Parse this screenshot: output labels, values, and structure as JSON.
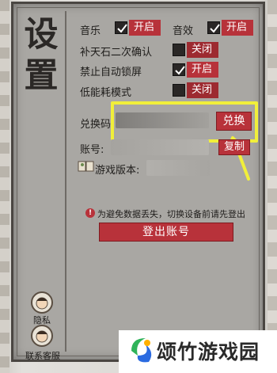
{
  "settings": {
    "title": "设置",
    "music_label": "音乐",
    "music_toggle": "开启",
    "sfx_label": "音效",
    "sfx_toggle": "开启",
    "confirm_label": "补天石二次确认",
    "confirm_toggle": "关闭",
    "autolock_label": "禁止自动锁屏",
    "autolock_toggle": "开启",
    "lowpower_label": "低能耗模式",
    "lowpower_toggle": "关闭",
    "redeem_label": "兑换码",
    "redeem_button": "兑换",
    "account_label": "账号:",
    "copy_button": "复制",
    "version_label": "游戏版本:",
    "warning_icon": "exclamation-icon",
    "warning_text": "为避免数据丢失，切换设备前请先登出",
    "logout_button": "登出账号",
    "privacy_label": "隐私",
    "support_label": "联系客服"
  },
  "colors": {
    "accent_red": "#b8323a",
    "highlight_yellow": "#f1ef3a"
  },
  "watermark": {
    "text": "颂竹游戏园"
  }
}
